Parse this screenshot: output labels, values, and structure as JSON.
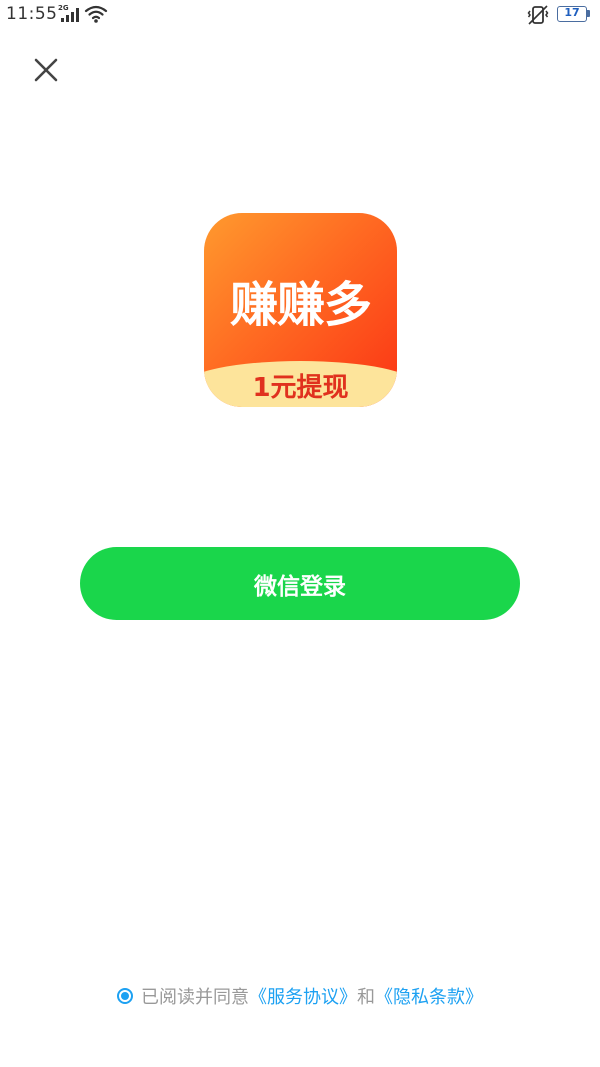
{
  "status_bar": {
    "time": "11:55",
    "network": "2G",
    "battery": "17"
  },
  "app": {
    "icon_name": "赚赚多",
    "icon_tagline": "1元提现",
    "colors": {
      "icon_gradient_start": "#ff9a2e",
      "icon_gradient_end": "#fb3314",
      "icon_band": "#fde49b",
      "tagline": "#e0311e"
    }
  },
  "login": {
    "button_label": "微信登录",
    "color": "#1ad64b"
  },
  "agreement": {
    "checked": true,
    "prefix": "已阅读并同意",
    "service_link": "《服务协议》",
    "conjunction": "和",
    "privacy_link": "《隐私条款》",
    "link_color": "#1da1f2"
  },
  "icons": [
    "close-icon",
    "signal-icon",
    "wifi-icon",
    "vibrate-icon",
    "battery-icon",
    "radio-checked-icon"
  ]
}
